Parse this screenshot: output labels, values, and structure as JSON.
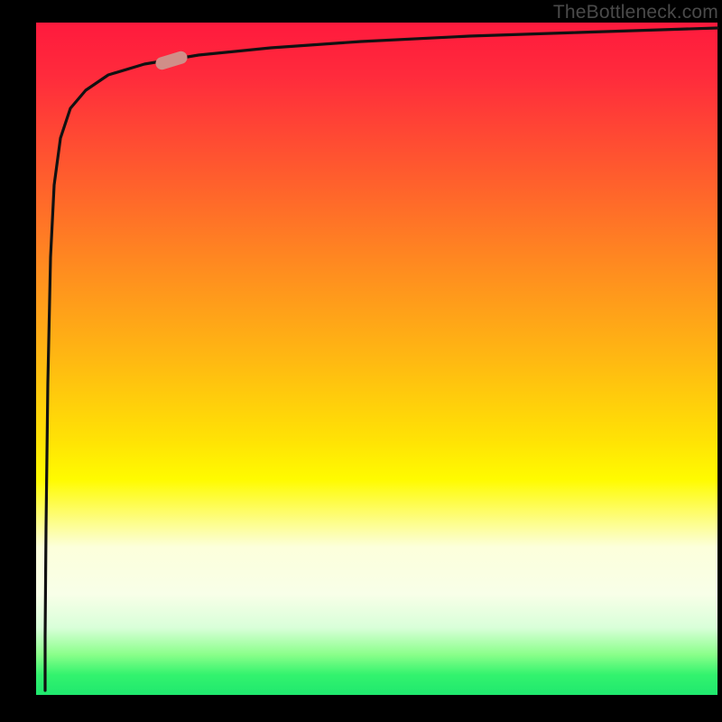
{
  "watermark": "TheBottleneck.com",
  "colors": {
    "background": "#000000",
    "gradient_top": "#ff1a3d",
    "gradient_mid": "#fffb00",
    "gradient_bottom": "#1fe86e",
    "curve": "#111111",
    "marker": "#d08e88"
  },
  "chart_data": {
    "type": "line",
    "title": "",
    "xlabel": "",
    "ylabel": "",
    "xlim": [
      0,
      100
    ],
    "ylim": [
      0,
      100
    ],
    "x": [
      0.5,
      1,
      1.5,
      2,
      3,
      4,
      6,
      8,
      12,
      20,
      30,
      45,
      60,
      80,
      100
    ],
    "values": [
      2,
      20,
      50,
      70,
      82,
      86,
      89.5,
      91,
      92.5,
      94,
      95,
      96,
      96.8,
      97.4,
      98
    ],
    "marker_point": {
      "x": 20,
      "y": 93
    },
    "grid": false,
    "legend": false,
    "background_gradient": "vertical red→yellow→green"
  }
}
